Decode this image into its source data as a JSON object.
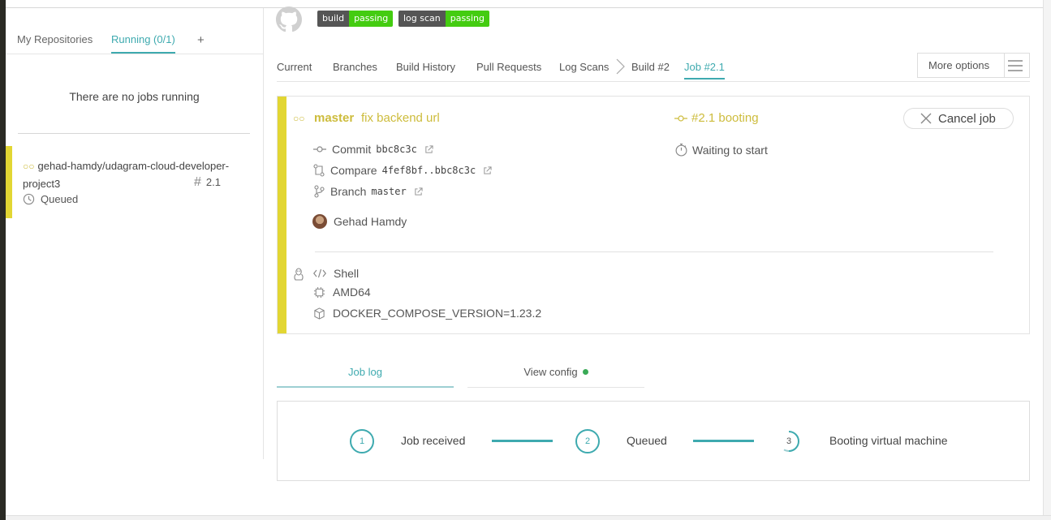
{
  "sidebar": {
    "tabs": {
      "my_repositories": "My Repositories",
      "running": "Running (0/1)",
      "add": "+"
    },
    "no_jobs_text": "There are no jobs running",
    "job_item": {
      "repo": "gehad-hamdy/udagram-cloud-developer-project3",
      "number": "2.1",
      "status": "Queued"
    }
  },
  "badges": {
    "build": {
      "label": "build",
      "value": "passing"
    },
    "log_scan": {
      "label": "log scan",
      "value": "passing"
    }
  },
  "tabs": {
    "current": "Current",
    "branches": "Branches",
    "build_history": "Build History",
    "pull_requests": "Pull Requests",
    "log_scans": "Log Scans",
    "build": "Build #2",
    "job": "Job #2.1",
    "more_options": "More options"
  },
  "job": {
    "branch": "master",
    "message": "fix backend url",
    "commit_label": "Commit",
    "commit_sha": "bbc8c3c",
    "compare_label": "Compare",
    "compare_range": "4fef8bf..bbc8c3c",
    "branch_label": "Branch",
    "branch_value": "master",
    "author": "Gehad Hamdy",
    "language": "Shell",
    "arch": "AMD64",
    "env": "DOCKER_COMPOSE_VERSION=1.23.2",
    "state": "#2.1 booting",
    "waiting": "Waiting to start",
    "cancel": "Cancel job"
  },
  "log_tabs": {
    "job_log": "Job log",
    "view_config": "View config"
  },
  "progress": {
    "steps": [
      {
        "number": "1",
        "label": "Job received"
      },
      {
        "number": "2",
        "label": "Queued"
      },
      {
        "number": "3",
        "label": "Booting virtual machine"
      }
    ]
  },
  "colors": {
    "accent": "#3eaaaf",
    "created_yellow": "#e2d633",
    "text_yellow": "#cdbc3c",
    "badge_green": "#44cc11",
    "config_dot_green": "#39aa56"
  },
  "icons": [
    "github-icon",
    "clock-icon",
    "hash-icon",
    "commit-icon",
    "compare-icon",
    "branch-icon",
    "external-link-icon",
    "linux-icon",
    "code-icon",
    "cpu-icon",
    "box-icon",
    "stopwatch-icon",
    "close-icon",
    "hamburger-icon",
    "chevron-right-icon"
  ]
}
